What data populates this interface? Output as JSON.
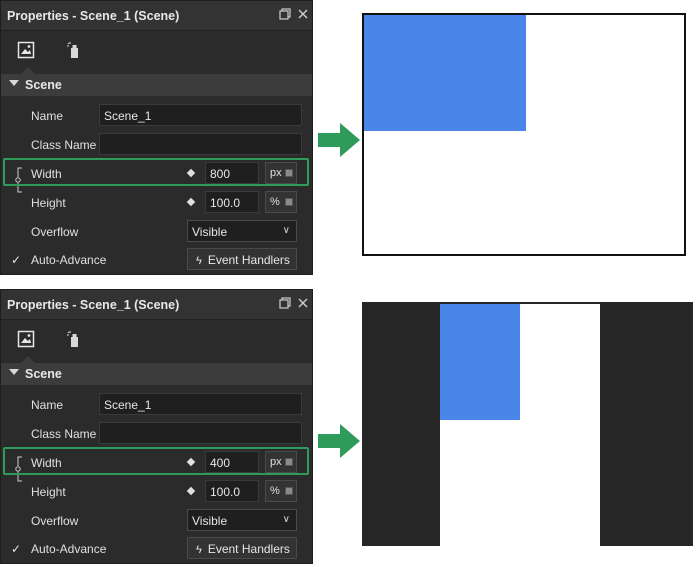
{
  "colors": {
    "accent_blue": "#4a86e8",
    "highlight_green": "#2e9b5a",
    "panel_bg": "#2b2b2b",
    "dark_stage": "#262626"
  },
  "icons": {
    "maximize": "restore-window-icon",
    "close": "close-icon",
    "tool1": "image-icon",
    "tool2": "spray-bottle-icon"
  },
  "panels": [
    {
      "title": "Properties - Scene_1 (Scene)",
      "section": "Scene",
      "name_label": "Name",
      "name_value": "Scene_1",
      "class_label": "Class Name",
      "class_value": "",
      "width_label": "Width",
      "width_value": "800",
      "width_unit": "px",
      "height_label": "Height",
      "height_value": "100.0",
      "height_unit": "%",
      "overflow_label": "Overflow",
      "overflow_value": "Visible",
      "auto_advance_label": "Auto-Advance",
      "event_handlers_label": "Event Handlers"
    },
    {
      "title": "Properties - Scene_1 (Scene)",
      "section": "Scene",
      "name_label": "Name",
      "name_value": "Scene_1",
      "class_label": "Class Name",
      "class_value": "",
      "width_label": "Width",
      "width_value": "400",
      "width_unit": "px",
      "height_label": "Height",
      "height_value": "100.0",
      "height_unit": "%",
      "overflow_label": "Overflow",
      "overflow_value": "Visible",
      "auto_advance_label": "Auto-Advance",
      "event_handlers_label": "Event Handlers"
    }
  ]
}
